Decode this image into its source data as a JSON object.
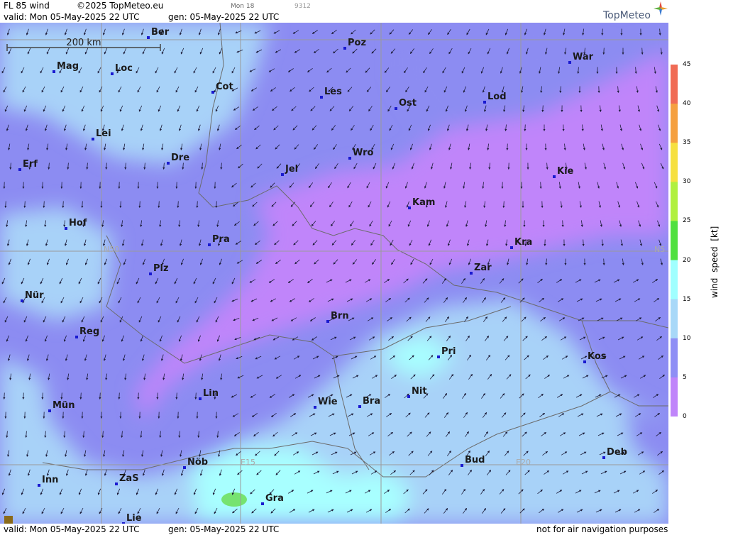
{
  "header": {
    "product": "FL 85 wind",
    "copyright": "©2025 TopMeteo.eu",
    "run": "Mon 18",
    "code": "9312",
    "valid": "valid:  Mon  05-May-2025  22 UTC",
    "gen": "gen: 05-May-2025 22 UTC",
    "logo": "TopMeteo"
  },
  "footer": {
    "valid": "valid:  Mon  05-May-2025  22 UTC",
    "gen": "gen: 05-May-2025 22 UTC",
    "disclaimer": "not for air navigation purposes"
  },
  "scale_bar": "200 km",
  "grid_labels": {
    "n50": "N50",
    "n50_right": "N5",
    "e15": "E15",
    "e20": "E20"
  },
  "legend": {
    "title": "wind  speed  [kt]",
    "ticks": [
      "45",
      "40",
      "35",
      "30",
      "25",
      "20",
      "15",
      "10",
      "5",
      "0"
    ],
    "colors": [
      "#f06b55",
      "#f5a040",
      "#f6e040",
      "#b0f040",
      "#50e040",
      "#a0ffff",
      "#a8d8f8",
      "#8f8ff5",
      "#c085fa"
    ]
  },
  "cities": [
    {
      "name": "Ber"
    },
    {
      "name": "Poz"
    },
    {
      "name": "War"
    },
    {
      "name": "Mag"
    },
    {
      "name": "Loc"
    },
    {
      "name": "Cot"
    },
    {
      "name": "Les"
    },
    {
      "name": "Ost"
    },
    {
      "name": "Lod"
    },
    {
      "name": "Lei"
    },
    {
      "name": "Dre"
    },
    {
      "name": "Wro"
    },
    {
      "name": "Erf"
    },
    {
      "name": "Jel"
    },
    {
      "name": "Kie"
    },
    {
      "name": "Kam"
    },
    {
      "name": "Hof"
    },
    {
      "name": "Pra"
    },
    {
      "name": "Kra"
    },
    {
      "name": "Plz"
    },
    {
      "name": "Zar"
    },
    {
      "name": "Nür"
    },
    {
      "name": "Brn"
    },
    {
      "name": "Reg"
    },
    {
      "name": "Pri"
    },
    {
      "name": "Kos"
    },
    {
      "name": "Lin"
    },
    {
      "name": "Nit"
    },
    {
      "name": "Wie"
    },
    {
      "name": "Bra"
    },
    {
      "name": "Mün"
    },
    {
      "name": "Deb"
    },
    {
      "name": "Nöb"
    },
    {
      "name": "Bud"
    },
    {
      "name": "Inn"
    },
    {
      "name": "ZaS"
    },
    {
      "name": "Gra"
    },
    {
      "name": "Lie"
    }
  ]
}
